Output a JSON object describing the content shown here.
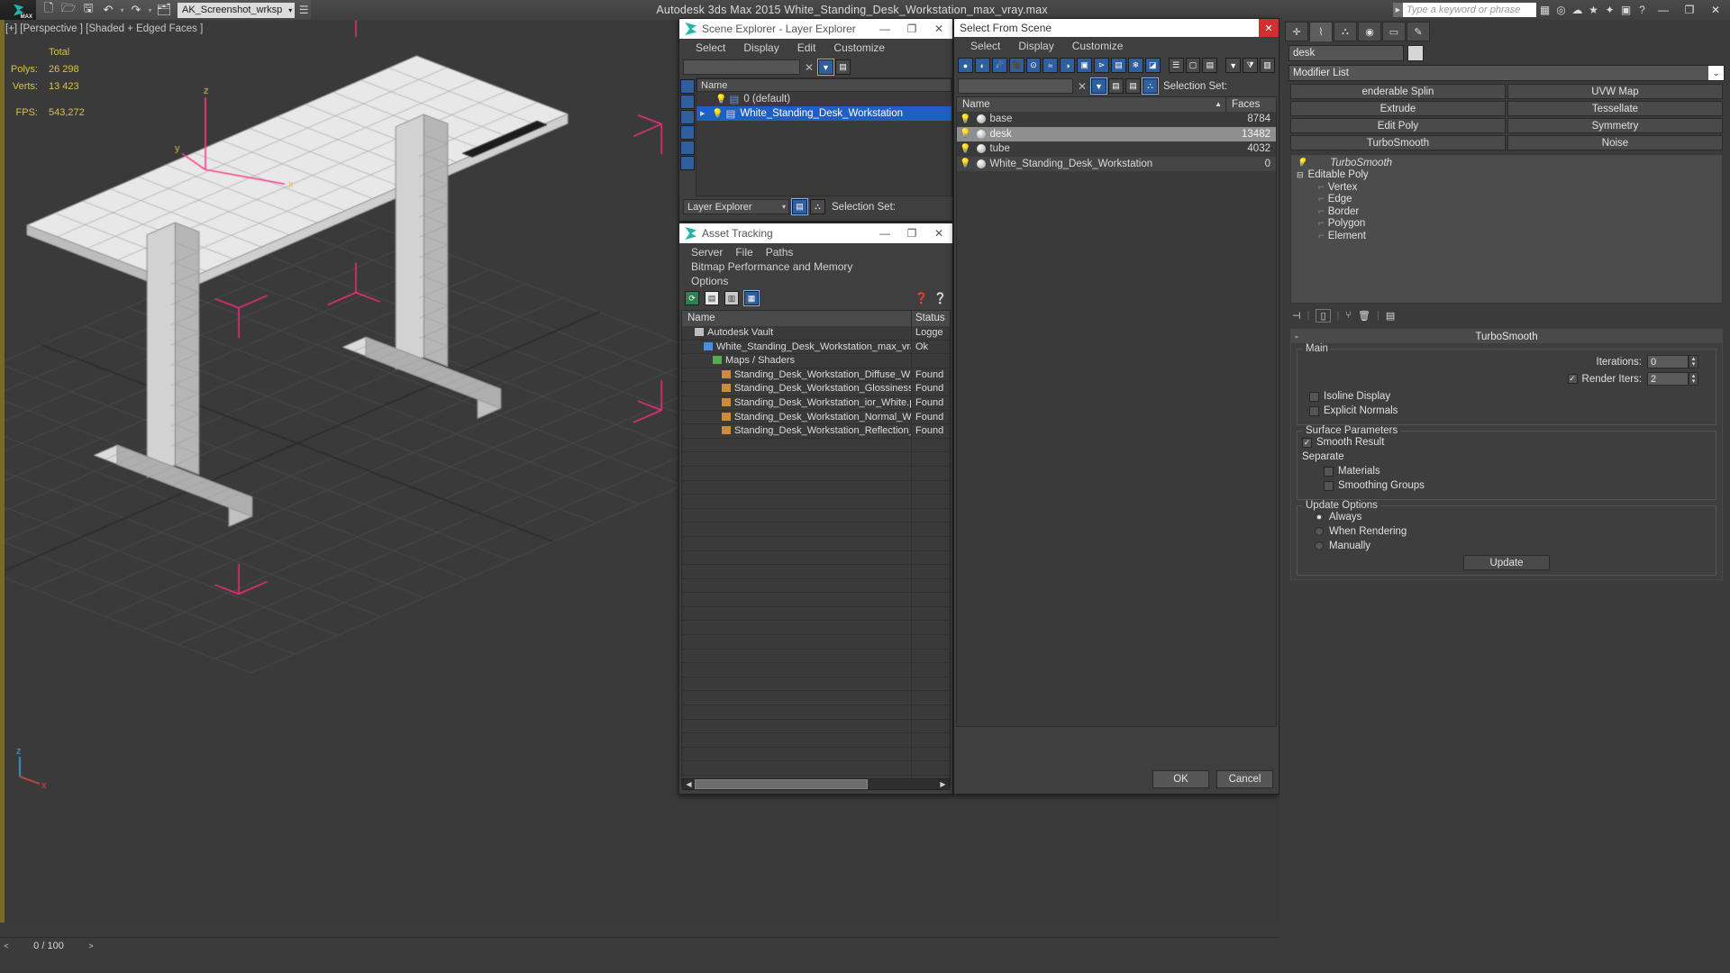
{
  "titlebar": {
    "logo": "3dsmax-logo-icon",
    "app_title": "Autodesk 3ds Max  2015     White_Standing_Desk_Workstation_max_vray.max",
    "workspace": "AK_Screenshot_wrksp",
    "quick_access": [
      {
        "name": "new-file-icon",
        "glyph": "🗋"
      },
      {
        "name": "open-file-icon",
        "glyph": "🗁"
      },
      {
        "name": "save-file-icon",
        "glyph": "🖫"
      },
      {
        "name": "undo-icon",
        "glyph": "↶"
      },
      {
        "name": "redo-icon",
        "glyph": "↷"
      },
      {
        "name": "set-project-folder-icon",
        "glyph": "🗂"
      }
    ],
    "search_placeholder": "Type a keyword or phrase",
    "right_icons": [
      {
        "name": "workspaces-icon",
        "glyph": "▦"
      },
      {
        "name": "autodesk-360-icon",
        "glyph": "◎"
      },
      {
        "name": "sign-in-icon",
        "glyph": "👤"
      },
      {
        "name": "favorites-icon",
        "glyph": "★"
      },
      {
        "name": "exchange-app-store-icon",
        "glyph": "✦"
      },
      {
        "name": "communication-center-icon",
        "glyph": "💬"
      },
      {
        "name": "help-icon",
        "glyph": "?"
      }
    ],
    "window_buttons": [
      {
        "name": "minimize-button",
        "glyph": "—"
      },
      {
        "name": "restore-button",
        "glyph": "❐"
      },
      {
        "name": "close-button",
        "glyph": "✕"
      }
    ]
  },
  "viewport": {
    "label": "[+] [Perspective ] [Shaded + Edged Faces ]",
    "stats": {
      "col_header": "Total",
      "rows": [
        {
          "label": "Polys:",
          "value": "26 298"
        },
        {
          "label": "Verts:",
          "value": "13 423"
        }
      ],
      "fps_label": "FPS:",
      "fps_value": "543,272"
    },
    "axis_labels": [
      "z",
      "y",
      "x"
    ],
    "world_axis": [
      "z",
      "x"
    ]
  },
  "scene_explorer": {
    "title": "Scene Explorer - Layer Explorer",
    "window_buttons": [
      {
        "name": "minimize-button",
        "glyph": "—"
      },
      {
        "name": "maximize-button",
        "glyph": "❐"
      },
      {
        "name": "close-button",
        "glyph": "✕"
      }
    ],
    "menus": [
      "Select",
      "Display",
      "Edit",
      "Customize"
    ],
    "search_value": "",
    "column_header": "Name",
    "rows": [
      {
        "name": "0 (default)",
        "selected": false,
        "expandable": false
      },
      {
        "name": "White_Standing_Desk_Workstation",
        "selected": true,
        "expandable": true
      }
    ],
    "footer": {
      "combo_value": "Layer Explorer",
      "selection_set_label": "Selection Set:"
    }
  },
  "asset_tracking": {
    "title": "Asset Tracking",
    "window_buttons": [
      {
        "name": "minimize-button",
        "glyph": "—"
      },
      {
        "name": "maximize-button",
        "glyph": "❐"
      },
      {
        "name": "close-button",
        "glyph": "✕"
      }
    ],
    "menus": [
      "Server",
      "File",
      "Paths",
      "Bitmap Performance and Memory",
      "Options"
    ],
    "columns": {
      "name": "Name",
      "status": "Status"
    },
    "rows": [
      {
        "name": "Autodesk Vault",
        "status": "Logge",
        "indent": 1,
        "icon": "vault-icon"
      },
      {
        "name": "White_Standing_Desk_Workstation_max_vray.max",
        "status": "Ok",
        "indent": 2,
        "icon": "max-file-icon"
      },
      {
        "name": "Maps / Shaders",
        "status": "",
        "indent": 3,
        "icon": "maps-shaders-icon"
      },
      {
        "name": "Standing_Desk_Workstation_Diffuse_White...",
        "status": "Found",
        "indent": 4,
        "icon": "bitmap-icon"
      },
      {
        "name": "Standing_Desk_Workstation_Glossiness_W...",
        "status": "Found",
        "indent": 4,
        "icon": "bitmap-icon"
      },
      {
        "name": "Standing_Desk_Workstation_ior_White.png",
        "status": "Found",
        "indent": 4,
        "icon": "bitmap-icon"
      },
      {
        "name": "Standing_Desk_Workstation_Normal_Whit...",
        "status": "Found",
        "indent": 4,
        "icon": "bitmap-icon"
      },
      {
        "name": "Standing_Desk_Workstation_Reflection_W...",
        "status": "Found",
        "indent": 4,
        "icon": "bitmap-icon"
      }
    ],
    "empty_rows": 25
  },
  "select_from_scene": {
    "title": "Select From Scene",
    "close_glyph": "✕",
    "menus": [
      "Select",
      "Display",
      "Customize"
    ],
    "search_value": "",
    "selection_set_label": "Selection Set:",
    "columns": {
      "name": "Name",
      "faces": "Faces"
    },
    "sort_mark": "▲",
    "rows": [
      {
        "name": "base",
        "faces": "8784",
        "selected": false
      },
      {
        "name": "desk",
        "faces": "13482",
        "selected": true
      },
      {
        "name": "tube",
        "faces": "4032",
        "selected": false
      },
      {
        "name": "White_Standing_Desk_Workstation",
        "faces": "0",
        "selected": false
      }
    ],
    "buttons": {
      "ok": "OK",
      "cancel": "Cancel"
    }
  },
  "command_panel": {
    "tabs": [
      {
        "name": "create-tab",
        "glyph": "✛"
      },
      {
        "name": "modify-tab",
        "glyph": "⌇",
        "active": true
      },
      {
        "name": "hierarchy-tab",
        "glyph": "⛓"
      },
      {
        "name": "motion-tab",
        "glyph": "◉"
      },
      {
        "name": "display-tab",
        "glyph": "🖵"
      },
      {
        "name": "utilities-tab",
        "glyph": "✎"
      }
    ],
    "object_name": "desk",
    "modifier_list_label": "Modifier List",
    "modifier_buttons": [
      "enderable Splin",
      "UVW Map",
      "Extrude",
      "Tessellate",
      "Edit Poly",
      "Symmetry",
      "TurboSmooth",
      "Noise"
    ],
    "modifier_stack": [
      {
        "label": "TurboSmooth",
        "italic": true,
        "sub": false
      },
      {
        "label": "Editable Poly",
        "italic": false,
        "sub": false
      },
      {
        "label": "Vertex",
        "italic": false,
        "sub": true
      },
      {
        "label": "Edge",
        "italic": false,
        "sub": true
      },
      {
        "label": "Border",
        "italic": false,
        "sub": true
      },
      {
        "label": "Polygon",
        "italic": false,
        "sub": true
      },
      {
        "label": "Element",
        "italic": false,
        "sub": true
      }
    ],
    "stack_icons": [
      {
        "name": "pin-stack-icon",
        "glyph": "⊣"
      },
      {
        "name": "show-end-result-icon",
        "glyph": "▯"
      },
      {
        "name": "make-unique-icon",
        "glyph": "⑂"
      },
      {
        "name": "remove-modifier-icon",
        "glyph": "🗑"
      },
      {
        "name": "configure-modifier-sets-icon",
        "glyph": "▤"
      }
    ],
    "turbosmooth": {
      "rollup_title": "TurboSmooth",
      "rollup_minus": "-",
      "main_group": "Main",
      "iterations_label": "Iterations:",
      "iterations_value": "0",
      "render_iters_label": "Render Iters:",
      "render_iters_value": "2",
      "render_iters_checked": true,
      "isoline_label": "Isoline Display",
      "isoline_checked": false,
      "explicit_normals_label": "Explicit Normals",
      "explicit_normals_checked": false,
      "surface_group": "Surface Parameters",
      "smooth_result_label": "Smooth Result",
      "smooth_result_checked": true,
      "separate_label": "Separate",
      "materials_label": "Materials",
      "materials_checked": false,
      "smoothing_groups_label": "Smoothing Groups",
      "smoothing_groups_checked": false,
      "update_group": "Update Options",
      "update_options": [
        {
          "label": "Always",
          "selected": true
        },
        {
          "label": "When Rendering",
          "selected": false
        },
        {
          "label": "Manually",
          "selected": false
        }
      ],
      "update_button": "Update"
    }
  },
  "statusbar": {
    "frame_indicator": "0 / 100",
    "prev_glyph": "<",
    "next_glyph": ">"
  },
  "colors": {
    "accent_blue": "#1f5fc4",
    "toolbutton_blue": "#2f5f9e",
    "stats_yellow": "#d6c24a",
    "close_red": "#cf3030",
    "panel_bg": "#3b3b3b",
    "grid_line": "#4a4a4a",
    "selection_pink": "#ff2f7f"
  }
}
